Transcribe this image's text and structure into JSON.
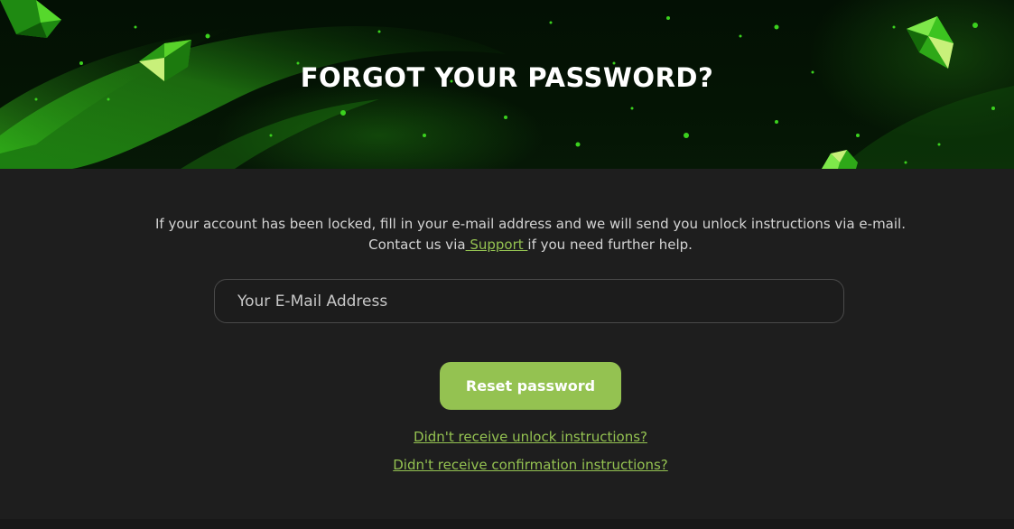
{
  "hero": {
    "title": "FORGOT YOUR PASSWORD?"
  },
  "intro": {
    "line1": "If your account has been locked, fill in your e-mail address and we will send you unlock instructions via e-mail.",
    "contact_prefix": "Contact us via",
    "support_link": " Support ",
    "contact_suffix": "if you need further help."
  },
  "form": {
    "email_placeholder": "Your E-Mail Address",
    "email_value": "",
    "submit_label": "Reset password"
  },
  "links": {
    "unlock": "Didn't receive unlock instructions?",
    "confirmation": "Didn't receive confirmation instructions?"
  },
  "colors": {
    "accent": "#94c251",
    "background": "#1e1e1e",
    "hero_base": "#041404"
  },
  "icons": {
    "gem": "emerald-gem-icon"
  }
}
